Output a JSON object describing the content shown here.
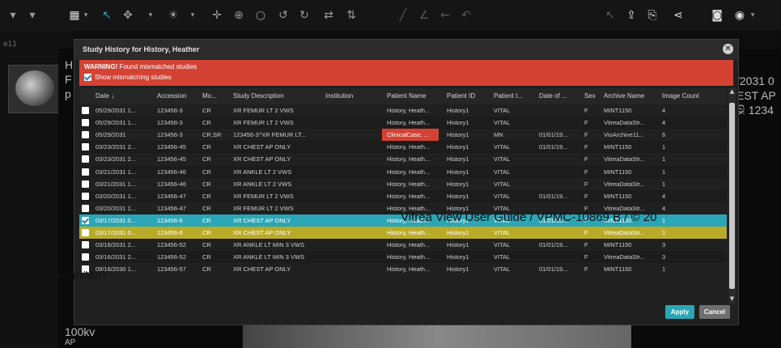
{
  "toolbar": {
    "icons": [
      "filter-icon",
      "layout-icon",
      "pointer-icon",
      "pan-icon",
      "brightness-icon",
      "move-icon",
      "zoom-in-icon",
      "magnify-icon",
      "rotate-left-icon",
      "rotate-right-icon",
      "flip-icon",
      "flip-v-icon",
      "line-icon",
      "angle-icon",
      "arrow-icon",
      "undo-icon",
      "export-icon",
      "share-icon",
      "share-tree-icon",
      "camera-icon",
      "eye-icon"
    ]
  },
  "left_panel": {
    "header": "e11"
  },
  "viewer": {
    "left_overlay": [
      "H",
      "F",
      "p"
    ],
    "right_overlay": [
      "/2031 0",
      "EST AP C",
      "c: 1234"
    ],
    "bottom_left": [
      "100kv",
      "AP"
    ]
  },
  "dialog": {
    "title": "Study History for History, Heather",
    "warning_bold": "WARNING!",
    "warning_text": " Found mismatched studies",
    "show_mismatch_label": "Show mismatching studies",
    "apply_label": "Apply",
    "cancel_label": "Cancel"
  },
  "table": {
    "columns": [
      "Date ↓",
      "Accession",
      "Mo...",
      "Study Description",
      "Institution",
      "Patient Name",
      "Patient ID",
      "Patient I...",
      "Date of ...",
      "Sex",
      "Archive Name",
      "Image Count"
    ],
    "rows": [
      {
        "checked": false,
        "style": "",
        "cells": [
          "05/29/2031 1...",
          "123456-3",
          "CR",
          "XR FEMUR LT 2 VWS",
          "",
          "History, Heath...",
          "History1",
          "VITAL",
          "",
          "F",
          "MINT1150",
          "4"
        ]
      },
      {
        "checked": false,
        "style": "alt",
        "cells": [
          "05/29/2031 1...",
          "123456-3",
          "CR",
          "XR FEMUR LT 2 VWS",
          "",
          "History, Heath...",
          "History1",
          "VITAL",
          "",
          "F",
          "VitreaDataStr...",
          "4"
        ]
      },
      {
        "checked": false,
        "style": "",
        "redname": true,
        "cells": [
          "05/29/2031",
          "123456-3",
          "CR,SR",
          "123456-3^XR FEMUR LT...",
          "",
          "ClinicalCase, ...",
          "History1",
          "MN",
          "01/01/19...",
          "F",
          "VioArchive11...",
          "6"
        ]
      },
      {
        "checked": false,
        "style": "alt",
        "cells": [
          "03/23/2031 2...",
          "123456-45",
          "CR",
          "XR CHEST AP ONLY",
          "",
          "History, Heath...",
          "History1",
          "VITAL",
          "01/01/19...",
          "F",
          "MINT1150",
          "1"
        ]
      },
      {
        "checked": false,
        "style": "",
        "cells": [
          "03/23/2031 2...",
          "123456-45",
          "CR",
          "XR CHEST AP ONLY",
          "",
          "History, Heath...",
          "History1",
          "VITAL",
          "",
          "F",
          "VitreaDataStr...",
          "1"
        ]
      },
      {
        "checked": false,
        "style": "alt",
        "cells": [
          "03/21/2031 1...",
          "123456-46",
          "CR",
          "XR ANKLE LT 2 VWS",
          "",
          "History, Heath...",
          "History1",
          "VITAL",
          "",
          "F",
          "MINT1150",
          "1"
        ]
      },
      {
        "checked": false,
        "style": "",
        "cells": [
          "03/21/2031 1...",
          "123456-46",
          "CR",
          "XR ANKLE LT 2 VWS",
          "",
          "History, Heath...",
          "History1",
          "VITAL",
          "",
          "F",
          "VitreaDataStr...",
          "1"
        ]
      },
      {
        "checked": false,
        "style": "alt",
        "cells": [
          "03/20/2031 1...",
          "123456-47",
          "CR",
          "XR FEMUR LT 2 VWS",
          "",
          "History, Heath...",
          "History1",
          "VITAL",
          "01/01/19...",
          "F",
          "MINT1150",
          "4"
        ]
      },
      {
        "checked": false,
        "style": "",
        "cells": [
          "03/20/2031 1...",
          "123456-47",
          "CR",
          "XR FEMUR LT 2 VWS",
          "",
          "History, Heath...",
          "History1",
          "VITAL",
          "",
          "F",
          "VitreaDataStr...",
          "4"
        ]
      },
      {
        "checked": true,
        "style": "sel",
        "cells": [
          "03/17/2031 0...",
          "123456-6",
          "CR",
          "XR CHEST AP ONLY",
          "",
          "History, Heath...",
          "History1",
          "VITAL",
          "01/01/19...",
          "F",
          "MINT1150",
          "1"
        ]
      },
      {
        "checked": false,
        "style": "hi",
        "cells": [
          "03/17/2031 0...",
          "123456-6",
          "CR",
          "XR CHEST AP ONLY",
          "",
          "History, Heath...",
          "History1",
          "VITAL",
          "",
          "F",
          "VitreaDataStr...",
          "1"
        ]
      },
      {
        "checked": false,
        "style": "",
        "cells": [
          "03/16/2031 2...",
          "123456-52",
          "CR",
          "XR ANKLE LT MIN 3 VWS",
          "",
          "History, Heath...",
          "History1",
          "VITAL",
          "01/01/19...",
          "F",
          "MINT1150",
          "3"
        ]
      },
      {
        "checked": false,
        "style": "alt",
        "cells": [
          "03/16/2031 2...",
          "123456-52",
          "CR",
          "XR ANKLE LT MIN 3 VWS",
          "",
          "History, Heath...",
          "History1",
          "VITAL",
          "",
          "F",
          "VitreaDataStr...",
          "3"
        ]
      },
      {
        "checked": false,
        "style": "",
        "cells": [
          "09/16/2030 1...",
          "123456-57",
          "CR",
          "XR CHEST AP ONLY",
          "",
          "History, Heath...",
          "History1",
          "VITAL",
          "01/01/19...",
          "F",
          "MINT1150",
          "1"
        ]
      }
    ]
  },
  "watermarks": {
    "line1": "Vitrea View User Guide / VPMC-10869 B / © 20",
    "line2": "s.medical.canon/MIIT"
  }
}
